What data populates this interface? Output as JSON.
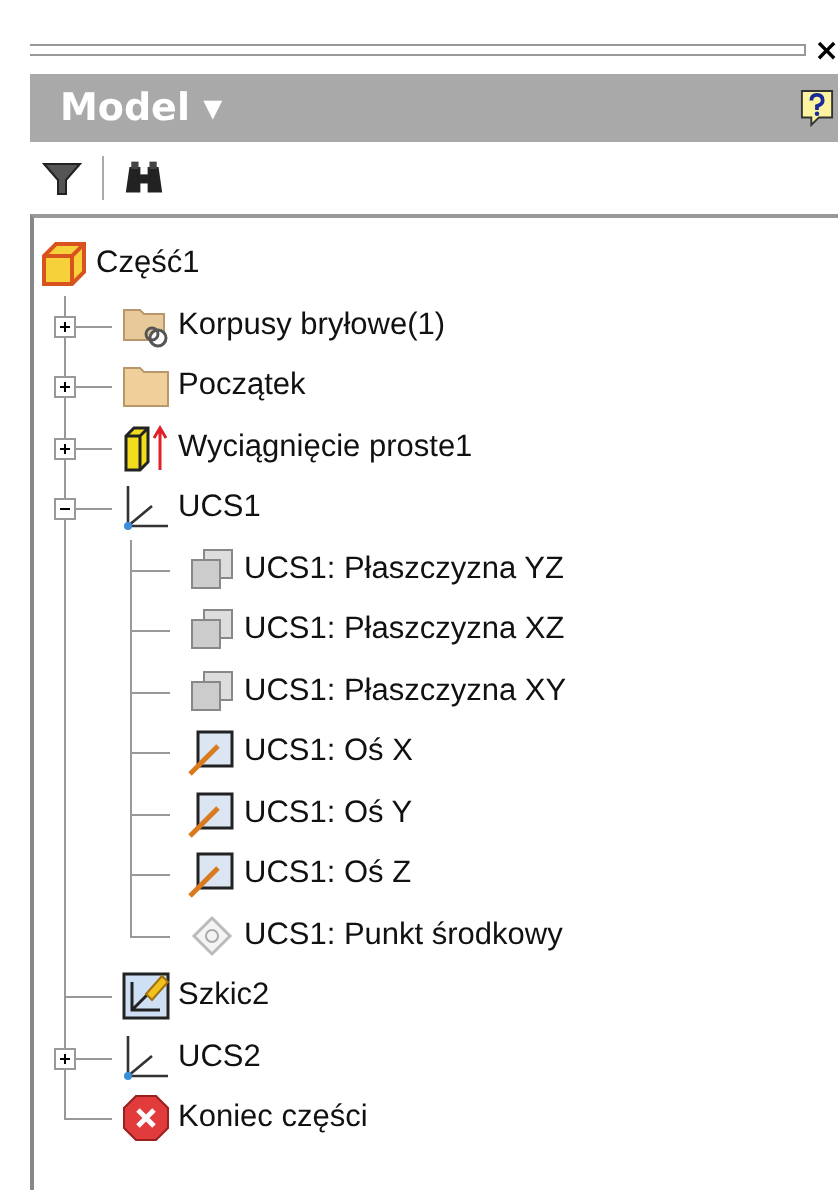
{
  "panel": {
    "close": "×",
    "title": "Model ▾"
  },
  "tree": {
    "label": "Część1",
    "kind": "part",
    "children": [
      {
        "label": "Korpusy bryłowe(1)",
        "kind": "solid-folder",
        "expanded": false
      },
      {
        "label": "Początek",
        "kind": "folder",
        "expanded": false
      },
      {
        "label": "Wyciągnięcie proste1",
        "kind": "extrusion",
        "expanded": false
      },
      {
        "label": "UCS1",
        "kind": "ucs",
        "expanded": true,
        "children": [
          {
            "label": "UCS1: Płaszczyzna YZ",
            "kind": "plane"
          },
          {
            "label": "UCS1: Płaszczyzna XZ",
            "kind": "plane"
          },
          {
            "label": "UCS1: Płaszczyzna XY",
            "kind": "plane"
          },
          {
            "label": "UCS1: Oś X",
            "kind": "axis"
          },
          {
            "label": "UCS1: Oś Y",
            "kind": "axis"
          },
          {
            "label": "UCS1: Oś Z",
            "kind": "axis"
          },
          {
            "label": "UCS1: Punkt środkowy",
            "kind": "point"
          }
        ]
      },
      {
        "label": "Szkic2",
        "kind": "sketch"
      },
      {
        "label": "UCS2",
        "kind": "ucs",
        "expanded": false
      },
      {
        "label": "Koniec części",
        "kind": "end"
      }
    ]
  }
}
